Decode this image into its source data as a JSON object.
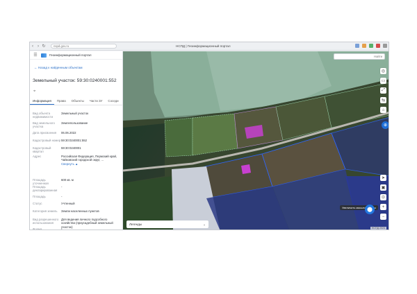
{
  "browser": {
    "url": "nspd.gov.ru",
    "tab_title": "НСПД | Геоинформационный портал",
    "back_icon": "arrow-left-icon",
    "forward_icon": "arrow-right-icon",
    "reload_icon": "reload-icon"
  },
  "app": {
    "brand": "Геоинформационный портал",
    "back_link": "← Назад к найденным объектам",
    "object_title": "Земельный участок: 59:30:0240001:552",
    "tabs": [
      "Информация",
      "Права",
      "Объекты",
      "Части ЗУ",
      "Соседи"
    ],
    "active_tab": 0
  },
  "properties": [
    {
      "label": "Вид объекта недвижимости",
      "value": "Земельный участок"
    },
    {
      "label": "Вид земельного участка",
      "value": "Землепользование"
    },
    {
      "label": "Дата присвоения",
      "value": "06.06.2022"
    },
    {
      "label": "Кадастровый номер",
      "value": "59:30:0240001:552"
    },
    {
      "label": "Кадастровый квартал",
      "value": "59:30:0240001"
    },
    {
      "label": "Адрес",
      "value": "Российская Федерация, Пермский край, Чайковский городской округ, ...",
      "link": "Свернуть ▲"
    },
    {
      "label": "Площадь уточненная",
      "value": "600 кв. м"
    },
    {
      "label": "Площадь декларированная",
      "value": "-"
    },
    {
      "label": "Площадь",
      "value": "-"
    },
    {
      "label": "Статус",
      "value": "Учтенный"
    },
    {
      "label": "Категория земель",
      "value": "Земли населенных пунктов"
    },
    {
      "label": "Вид разрешенного использования",
      "value": "Для ведения личного подсобного хозяйства (приусадебный земельный участок)"
    },
    {
      "label": "Форма собственности",
      "value": "-"
    }
  ],
  "map": {
    "search_placeholder": "Найти",
    "layers_label": "Легенды",
    "tooltip": "Увеличить масштаб карты",
    "attribution": "НСПД 2024",
    "accent_color": "#2377e0",
    "parcel_color": "#8fbf9a",
    "selected_parcel_color": "#c840d0"
  }
}
